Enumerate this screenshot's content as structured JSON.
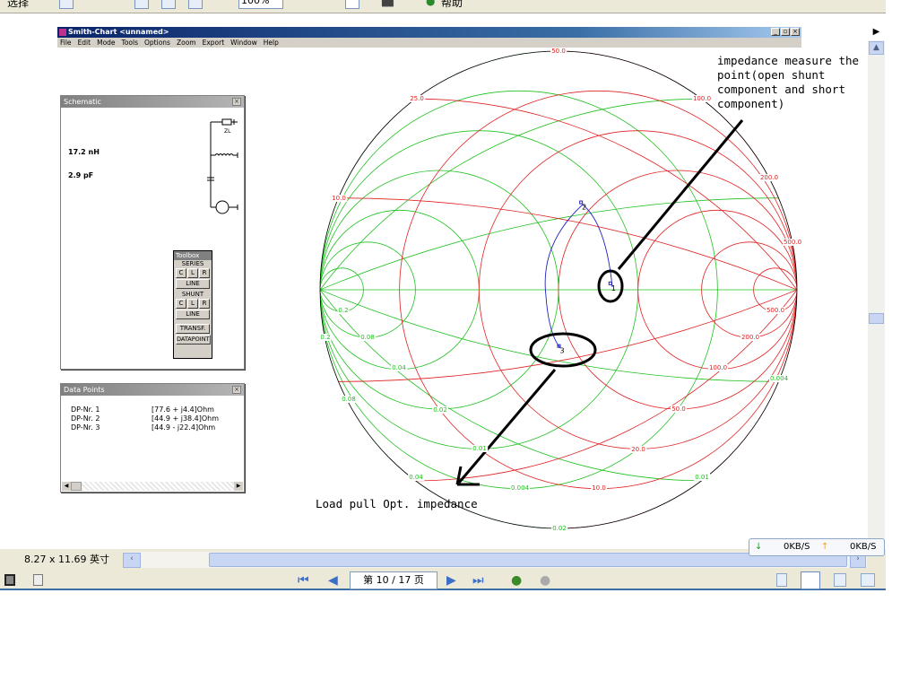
{
  "top_toolbar": {
    "select_label": "选择",
    "help_label": "帮助",
    "zoom_value": "100%"
  },
  "window": {
    "title": "Smith-Chart <unnamed>",
    "menu": [
      "File",
      "Edit",
      "Mode",
      "Tools",
      "Options",
      "Zoom",
      "Export",
      "Window",
      "Help"
    ],
    "buttons": {
      "minimize": "_",
      "maximize": "▫",
      "close": "×"
    }
  },
  "schematic": {
    "title": "Schematic",
    "close": "×",
    "values": [
      "17.2 nH",
      "2.9 pF"
    ],
    "load_label": "ZL"
  },
  "toolbox": {
    "title": "Toolbox",
    "series": "SERIES",
    "shunt": "SHUNT",
    "c": "C",
    "l": "L",
    "r": "R",
    "line": "LINE",
    "transf": "TRANSF.",
    "datapoint": "DATAPOINT"
  },
  "data_points": {
    "title": "Data Points",
    "close": "×",
    "rows": [
      {
        "name": "DP-Nr. 1",
        "value": "[77.6 + j4.4]Ohm",
        "re": 77.6,
        "im": 4.4
      },
      {
        "name": "DP-Nr. 2",
        "value": "[44.9 + j38.4]Ohm",
        "re": 44.9,
        "im": 38.4
      },
      {
        "name": "DP-Nr. 3",
        "value": "[44.9 - j22.4]Ohm",
        "re": 44.9,
        "im": -22.4
      }
    ]
  },
  "smith": {
    "z0": 50,
    "normalized_values": [
      0.2,
      0.5,
      1,
      2,
      4,
      10
    ],
    "colors": {
      "impedance": "#e02020",
      "admittance": "#20c020",
      "trace": "#2020c0",
      "outline": "#000000"
    },
    "labels": [
      "50.0",
      "25.0",
      "100.0",
      "200.0",
      "10.0",
      "500.0",
      "0.2",
      "0.08",
      "0.04",
      "0.08",
      "0.02",
      "0.01",
      "0.04",
      "0.004",
      "10.0",
      "20.0",
      "50.0",
      "100.0",
      "200.0",
      "500.0",
      "0.004",
      "0.01",
      "0.02",
      "0.2"
    ],
    "point_labels": [
      "1",
      "2",
      "3"
    ]
  },
  "annotations": {
    "top": "impedance measure the\npoint(open shunt\ncomponent and short\ncomponent)",
    "bottom": "Load pull Opt. impedance"
  },
  "status": {
    "page_size": "8.27 x 11.69 英寸",
    "page": "第 10 / 17 页",
    "down": "0KB/S",
    "up": "0KB/S"
  }
}
